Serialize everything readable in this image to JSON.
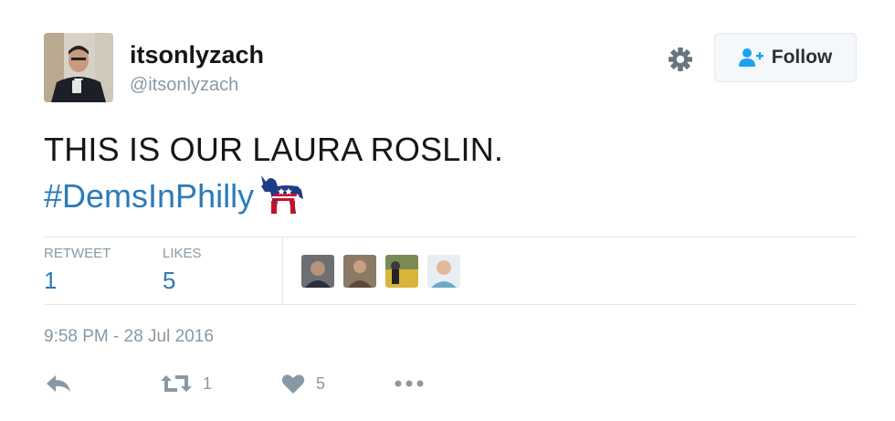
{
  "user": {
    "display_name": "itsonlyzach",
    "handle": "@itsonlyzach"
  },
  "header": {
    "follow_label": "Follow",
    "settings_icon": "gear-icon",
    "follow_icon": "add-user-icon"
  },
  "tweet": {
    "text": "THIS IS OUR LAURA ROSLIN.",
    "hashtag": "#DemsInPhilly",
    "emoji": "democratic-donkey-emoji"
  },
  "stats": {
    "retweets_label": "RETWEET",
    "retweets_value": "1",
    "likes_label": "LIKES",
    "likes_value": "5",
    "favoriters": [
      "liker-avatar-1",
      "liker-avatar-2",
      "liker-avatar-3",
      "liker-avatar-4"
    ]
  },
  "timestamp": "9:58 PM - 28 Jul 2016",
  "actions": {
    "reply_icon": "reply-icon",
    "retweet_icon": "retweet-icon",
    "retweet_count": "1",
    "like_icon": "heart-icon",
    "like_count": "5",
    "more_icon": "more-icon"
  },
  "colors": {
    "link": "#2b7bb9",
    "muted": "#8899a6",
    "text": "#14171a",
    "border": "#e1e8ed"
  }
}
